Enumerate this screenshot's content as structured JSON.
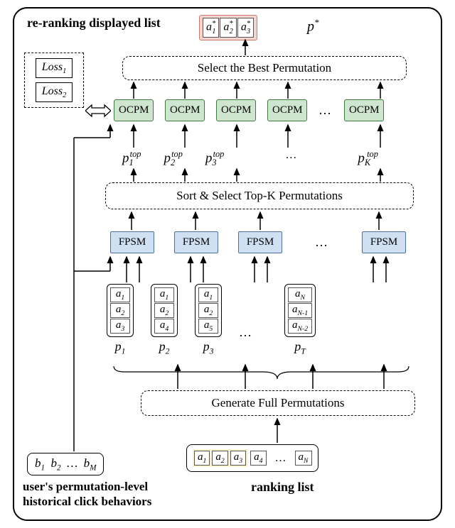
{
  "labels": {
    "rerank": "re-ranking displayed list",
    "select_best": "Select the Best Permutation",
    "sort_select": "Sort & Select Top-K Permutations",
    "gen_perms": "Generate Full Permutations",
    "hist": "user's permutation-level\nhistorical click behaviors",
    "ranking": "ranking list"
  },
  "output": {
    "items": [
      "a₁*",
      "a₂*",
      "a₃*"
    ],
    "p": "p*"
  },
  "losses": [
    "Loss₁",
    "Loss₂"
  ],
  "ocpm_label": "OCPM",
  "fpsm_label": "FPSM",
  "p_top": [
    "p₁ᵗᵒᵖ",
    "p₂ᵗᵒᵖ",
    "p₃ᵗᵒᵖ",
    "…",
    "p_Kᵗᵒᵖ"
  ],
  "perms": {
    "p1": {
      "id": "p₁",
      "items": [
        "a₁",
        "a₂",
        "a₃"
      ]
    },
    "p2": {
      "id": "p₂",
      "items": [
        "a₁",
        "a₂",
        "a₄"
      ]
    },
    "p3": {
      "id": "p₃",
      "items": [
        "a₁",
        "a₂",
        "a₅"
      ]
    },
    "pT": {
      "id": "p_T",
      "items": [
        "a_N",
        "a_{N-1}",
        "a_{N-2}"
      ]
    }
  },
  "hist_items": "b₁  b₂  …  b_M",
  "rank_items": [
    "a₁",
    "a₂",
    "a₃",
    "a₄",
    "…",
    "a_N"
  ],
  "chart_data": {
    "type": "diagram",
    "title": "Re-ranking pipeline",
    "nodes": [
      {
        "id": "ranking_list",
        "label": "ranking list",
        "items": [
          "a1",
          "a2",
          "a3",
          "a4",
          "…",
          "aN"
        ]
      },
      {
        "id": "hist",
        "label": "user's permutation-level historical click behaviors",
        "items": [
          "b1",
          "b2",
          "…",
          "bM"
        ]
      },
      {
        "id": "gen",
        "label": "Generate Full Permutations"
      },
      {
        "id": "perms",
        "label": "p1..pT",
        "children": [
          {
            "id": "p1",
            "items": [
              "a1",
              "a2",
              "a3"
            ]
          },
          {
            "id": "p2",
            "items": [
              "a1",
              "a2",
              "a4"
            ]
          },
          {
            "id": "p3",
            "items": [
              "a1",
              "a2",
              "a5"
            ]
          },
          {
            "id": "pT",
            "items": [
              "aN",
              "aN-1",
              "aN-2"
            ]
          }
        ]
      },
      {
        "id": "fpsm",
        "label": "FPSM",
        "count": 4
      },
      {
        "id": "sort",
        "label": "Sort & Select Top-K Permutations"
      },
      {
        "id": "ptop",
        "label": "p1_top..pK_top"
      },
      {
        "id": "ocpm",
        "label": "OCPM",
        "count": 5
      },
      {
        "id": "loss",
        "label": "Loss1, Loss2"
      },
      {
        "id": "select_best",
        "label": "Select the Best Permutation"
      },
      {
        "id": "output",
        "label": "p*",
        "items": [
          "a1*",
          "a2*",
          "a3*"
        ]
      }
    ],
    "edges": [
      [
        "ranking_list",
        "gen"
      ],
      [
        "gen",
        "perms"
      ],
      [
        "perms",
        "fpsm"
      ],
      [
        "hist",
        "fpsm"
      ],
      [
        "hist",
        "ocpm"
      ],
      [
        "fpsm",
        "sort"
      ],
      [
        "sort",
        "ptop"
      ],
      [
        "ptop",
        "ocpm"
      ],
      [
        "ocpm",
        "select_best"
      ],
      [
        "select_best",
        "output"
      ],
      [
        "loss",
        "ocpm"
      ]
    ]
  }
}
